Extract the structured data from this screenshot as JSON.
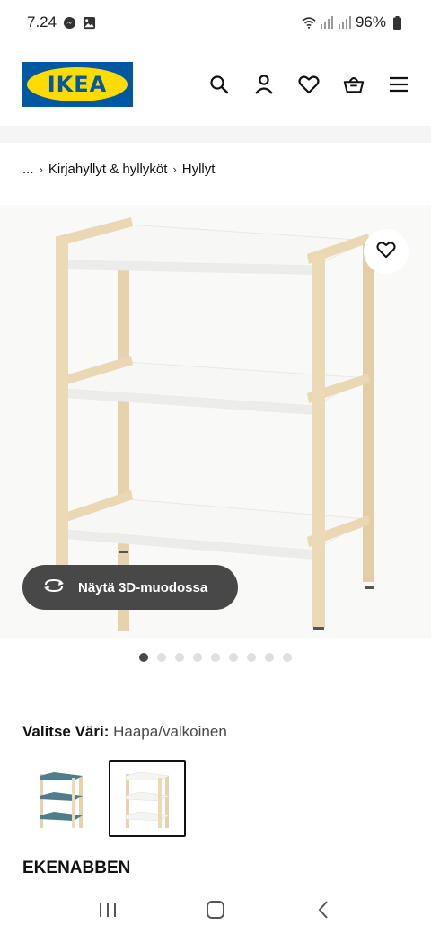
{
  "status_bar": {
    "time": "7.24",
    "battery": "96%",
    "icons": [
      "messenger-icon",
      "gallery-icon",
      "wifi-icon",
      "signal-icon",
      "battery-icon"
    ]
  },
  "header": {
    "logo_text": "IKEA",
    "colors": {
      "logo_blue": "#0058a3",
      "logo_yellow": "#ffdb00"
    },
    "icons": [
      "search-icon",
      "profile-icon",
      "heart-icon",
      "basket-icon",
      "menu-icon"
    ]
  },
  "breadcrumb": {
    "items": [
      "...",
      "Kirjahyllyt & hyllyköt",
      "Hyllyt"
    ]
  },
  "media": {
    "view_3d_label": "Näytä 3D-muodossa",
    "image_count": 9,
    "active_index": 1,
    "colors": {
      "birch": "#e8d4b0",
      "shelf_white": "#f7f7f5",
      "button_bg": "#484848"
    }
  },
  "product": {
    "color_label": "Valitse Väri:",
    "color_value": "Haapa/valkoinen",
    "name": "EKENABBEN",
    "swatch_colors": [
      "#4f7d8c",
      "#f4f4f1"
    ],
    "selected_swatch_index": 2
  },
  "system_nav": {
    "icons": [
      "recent-apps-icon",
      "home-icon",
      "back-icon"
    ]
  }
}
